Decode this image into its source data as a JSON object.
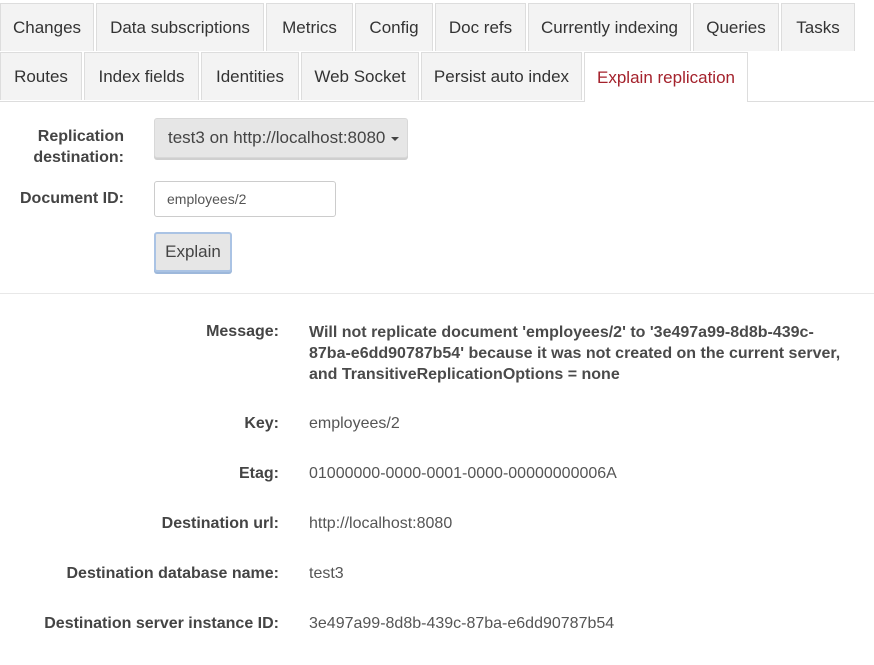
{
  "tabs": {
    "row1": [
      "Changes",
      "Data subscriptions",
      "Metrics",
      "Config",
      "Doc refs",
      "Currently indexing",
      "Queries",
      "Tasks"
    ],
    "row2": [
      "Routes",
      "Index fields",
      "Identities",
      "Web Socket",
      "Persist auto index",
      "Explain replication"
    ],
    "active": "Explain replication"
  },
  "form": {
    "destination_label_line1": "Replication",
    "destination_label_line2": "destination:",
    "destination_value": "test3 on http://localhost:8080",
    "document_id_label": "Document ID:",
    "document_id_value": "employees/2",
    "explain_button": "Explain"
  },
  "result": {
    "message_label": "Message:",
    "message_value": "Will not replicate document 'employees/2' to '3e497a99-8d8b-439c-87ba-e6dd90787b54' because it was not created on the current server, and TransitiveReplicationOptions = none",
    "key_label": "Key:",
    "key_value": "employees/2",
    "etag_label": "Etag:",
    "etag_value": "01000000-0000-0001-0000-00000000006A",
    "dest_url_label": "Destination url:",
    "dest_url_value": "http://localhost:8080",
    "dest_db_label": "Destination database name:",
    "dest_db_value": "test3",
    "dest_server_label": "Destination server instance ID:",
    "dest_server_value": "3e497a99-8d8b-439c-87ba-e6dd90787b54"
  },
  "colors": {
    "active_tab_text": "#a4222c",
    "tab_background": "#f3f3f3",
    "button_focus_border": "#aac3e4"
  }
}
